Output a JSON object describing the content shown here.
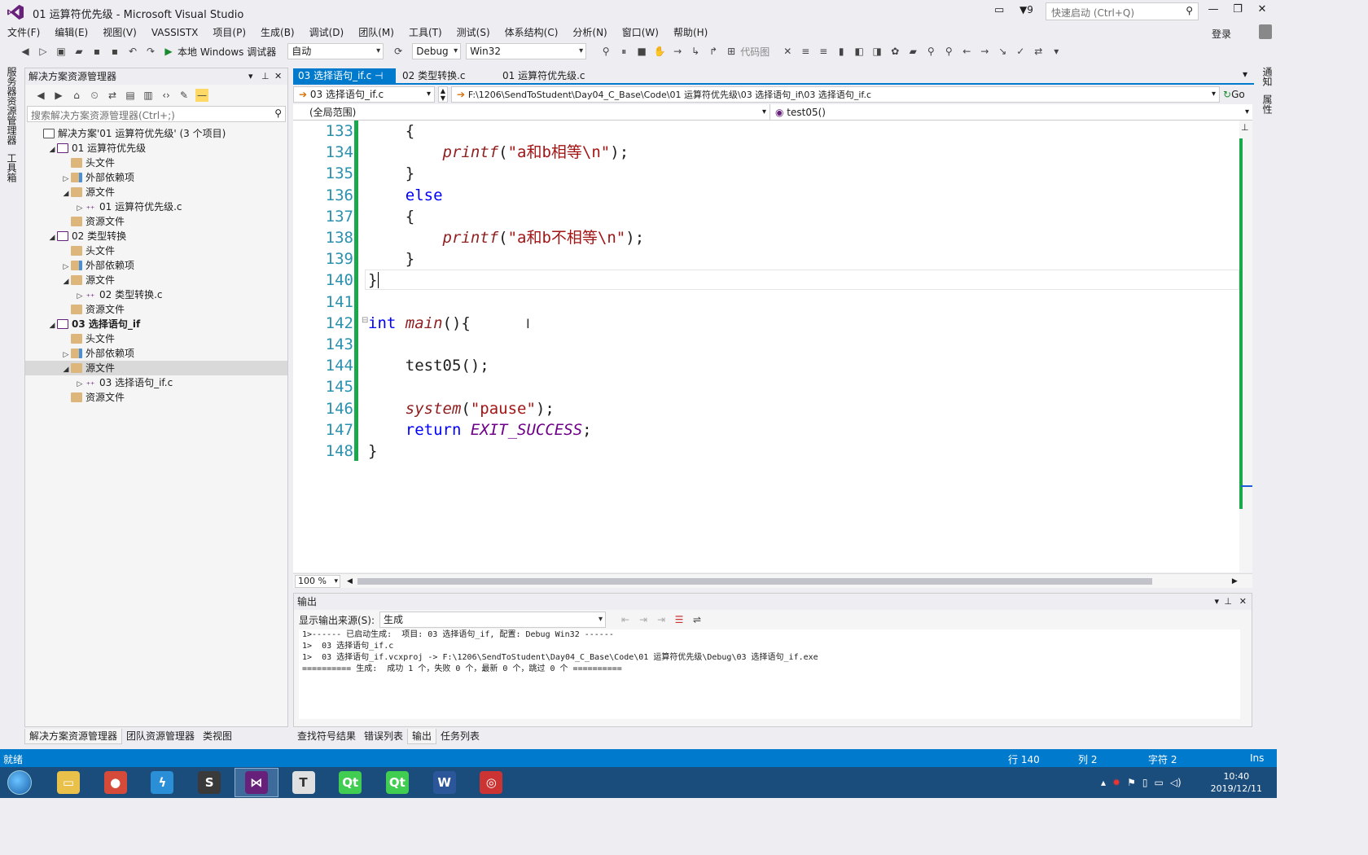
{
  "window": {
    "title": "01 运算符优先级 - Microsoft Visual Studio",
    "notification_count": "9",
    "quick_launch_placeholder": "快速启动 (Ctrl+Q)",
    "login": "登录"
  },
  "menu": [
    "文件(F)",
    "编辑(E)",
    "视图(V)",
    "VASSISTX",
    "项目(P)",
    "生成(B)",
    "调试(D)",
    "团队(M)",
    "工具(T)",
    "测试(S)",
    "体系结构(C)",
    "分析(N)",
    "窗口(W)",
    "帮助(H)"
  ],
  "toolbar": {
    "debugger_label": "本地 Windows 调试器",
    "auto_select": "自动",
    "config_select": "Debug",
    "platform_select": "Win32",
    "code_map": "代码图"
  },
  "left_strip_tabs": [
    "服务器资源管理器",
    "工具箱"
  ],
  "right_strip_tabs": [
    "通知",
    "属性"
  ],
  "solution_explorer": {
    "title": "解决方案资源管理器",
    "search_placeholder": "搜索解决方案资源管理器(Ctrl+;)",
    "tree": [
      {
        "label": "解决方案'01 运算符优先级' (3 个项目)",
        "indent": 0,
        "twisty": "",
        "icon": "sol",
        "bold": false,
        "selected": false
      },
      {
        "label": "01 运算符优先级",
        "indent": 1,
        "twisty": "◢",
        "icon": "proj",
        "bold": false,
        "selected": false
      },
      {
        "label": "头文件",
        "indent": 2,
        "twisty": "",
        "icon": "fold",
        "bold": false,
        "selected": false
      },
      {
        "label": "外部依赖项",
        "indent": 2,
        "twisty": "▷",
        "icon": "ext",
        "bold": false,
        "selected": false
      },
      {
        "label": "源文件",
        "indent": 2,
        "twisty": "◢",
        "icon": "fold",
        "bold": false,
        "selected": false
      },
      {
        "label": "01 运算符优先级.c",
        "indent": 3,
        "twisty": "▷",
        "icon": "cfile",
        "bold": false,
        "selected": false
      },
      {
        "label": "资源文件",
        "indent": 2,
        "twisty": "",
        "icon": "fold",
        "bold": false,
        "selected": false
      },
      {
        "label": "02 类型转换",
        "indent": 1,
        "twisty": "◢",
        "icon": "proj",
        "bold": false,
        "selected": false
      },
      {
        "label": "头文件",
        "indent": 2,
        "twisty": "",
        "icon": "fold",
        "bold": false,
        "selected": false
      },
      {
        "label": "外部依赖项",
        "indent": 2,
        "twisty": "▷",
        "icon": "ext",
        "bold": false,
        "selected": false
      },
      {
        "label": "源文件",
        "indent": 2,
        "twisty": "◢",
        "icon": "fold",
        "bold": false,
        "selected": false
      },
      {
        "label": "02 类型转换.c",
        "indent": 3,
        "twisty": "▷",
        "icon": "cfile",
        "bold": false,
        "selected": false
      },
      {
        "label": "资源文件",
        "indent": 2,
        "twisty": "",
        "icon": "fold",
        "bold": false,
        "selected": false
      },
      {
        "label": "03 选择语句_if",
        "indent": 1,
        "twisty": "◢",
        "icon": "proj",
        "bold": true,
        "selected": false
      },
      {
        "label": "头文件",
        "indent": 2,
        "twisty": "",
        "icon": "fold",
        "bold": false,
        "selected": false
      },
      {
        "label": "外部依赖项",
        "indent": 2,
        "twisty": "▷",
        "icon": "ext",
        "bold": false,
        "selected": false
      },
      {
        "label": "源文件",
        "indent": 2,
        "twisty": "◢",
        "icon": "fold",
        "bold": false,
        "selected": true
      },
      {
        "label": "03 选择语句_if.c",
        "indent": 3,
        "twisty": "▷",
        "icon": "cfile",
        "bold": false,
        "selected": false
      },
      {
        "label": "资源文件",
        "indent": 2,
        "twisty": "",
        "icon": "fold",
        "bold": false,
        "selected": false
      }
    ],
    "bottom_tabs": [
      "解决方案资源管理器",
      "团队资源管理器",
      "类视图"
    ]
  },
  "editor": {
    "tabs": [
      {
        "label": "03 选择语句_if.c",
        "active": true
      },
      {
        "label": "02 类型转换.c",
        "active": false
      },
      {
        "label": "01 运算符优先级.c",
        "active": false
      }
    ],
    "file_select": "03 选择语句_if.c",
    "path": "F:\\1206\\SendToStudent\\Day04_C_Base\\Code\\01 运算符优先级\\03 选择语句_if\\03 选择语句_if.c",
    "go": "Go",
    "scope": "(全局范围)",
    "member": "test05()",
    "zoom": "100 %",
    "lines": [
      {
        "n": "133",
        "html": "    {"
      },
      {
        "n": "134",
        "html": "        <span class='fn'>printf</span>(<span class='str'>\"a和b相等\\n\"</span>);"
      },
      {
        "n": "135",
        "html": "    }"
      },
      {
        "n": "136",
        "html": "    <span class='kw'>else</span>"
      },
      {
        "n": "137",
        "html": "    {"
      },
      {
        "n": "138",
        "html": "        <span class='fn'>printf</span>(<span class='str'>\"a和b不相等\\n\"</span>);"
      },
      {
        "n": "139",
        "html": "    }"
      },
      {
        "n": "140",
        "html": "}"
      },
      {
        "n": "141",
        "html": ""
      },
      {
        "n": "142",
        "html": "<span class='kw'>int</span> <span class='fn'>main</span>(){"
      },
      {
        "n": "143",
        "html": ""
      },
      {
        "n": "144",
        "html": "    test05();"
      },
      {
        "n": "145",
        "html": ""
      },
      {
        "n": "146",
        "html": "    <span class='fn'>system</span>(<span class='str'>\"pause\"</span>);"
      },
      {
        "n": "147",
        "html": "    <span class='kw'>return</span> <span class='mac'>EXIT_SUCCESS</span>;"
      },
      {
        "n": "148",
        "html": "}"
      }
    ]
  },
  "output": {
    "title": "输出",
    "source_label": "显示输出来源(S):",
    "source_value": "生成",
    "text": "1>------ 已启动生成:  项目: 03 选择语句_if, 配置: Debug Win32 ------\n1>  03 选择语句_if.c\n1>  03 选择语句_if.vcxproj -> F:\\1206\\SendToStudent\\Day04_C_Base\\Code\\01 运算符优先级\\Debug\\03 选择语句_if.exe\n========== 生成:  成功 1 个，失败 0 个，最新 0 个，跳过 0 个 ==========",
    "bottom_tabs": [
      {
        "label": "查找符号结果",
        "active": false
      },
      {
        "label": "错误列表",
        "active": false
      },
      {
        "label": "输出",
        "active": true
      },
      {
        "label": "任务列表",
        "active": false
      }
    ]
  },
  "status": {
    "ready": "就绪",
    "line": "行 140",
    "col": "列 2",
    "ch": "字符 2",
    "ins": "Ins"
  },
  "taskbar": {
    "apps": [
      {
        "name": "file-explorer",
        "glyph": "▭",
        "color": "#e8c04a"
      },
      {
        "name": "chrome",
        "glyph": "●",
        "color": "#d64a3a"
      },
      {
        "name": "thunder",
        "glyph": "ϟ",
        "color": "#2a8fd6"
      },
      {
        "name": "sublime-text",
        "glyph": "S",
        "color": "#3a3a3a"
      },
      {
        "name": "visual-studio",
        "glyph": "⋈",
        "color": "#68217a"
      },
      {
        "name": "typora",
        "glyph": "T",
        "color": "#e0e0e0"
      },
      {
        "name": "qt-creator",
        "glyph": "Qt",
        "color": "#41cd52"
      },
      {
        "name": "qt-designer",
        "glyph": "Qt",
        "color": "#41cd52"
      },
      {
        "name": "word",
        "glyph": "W",
        "color": "#2b579a"
      },
      {
        "name": "remote-app",
        "glyph": "◎",
        "color": "#c33"
      }
    ],
    "time": "10:40",
    "date": "2019/12/11"
  }
}
